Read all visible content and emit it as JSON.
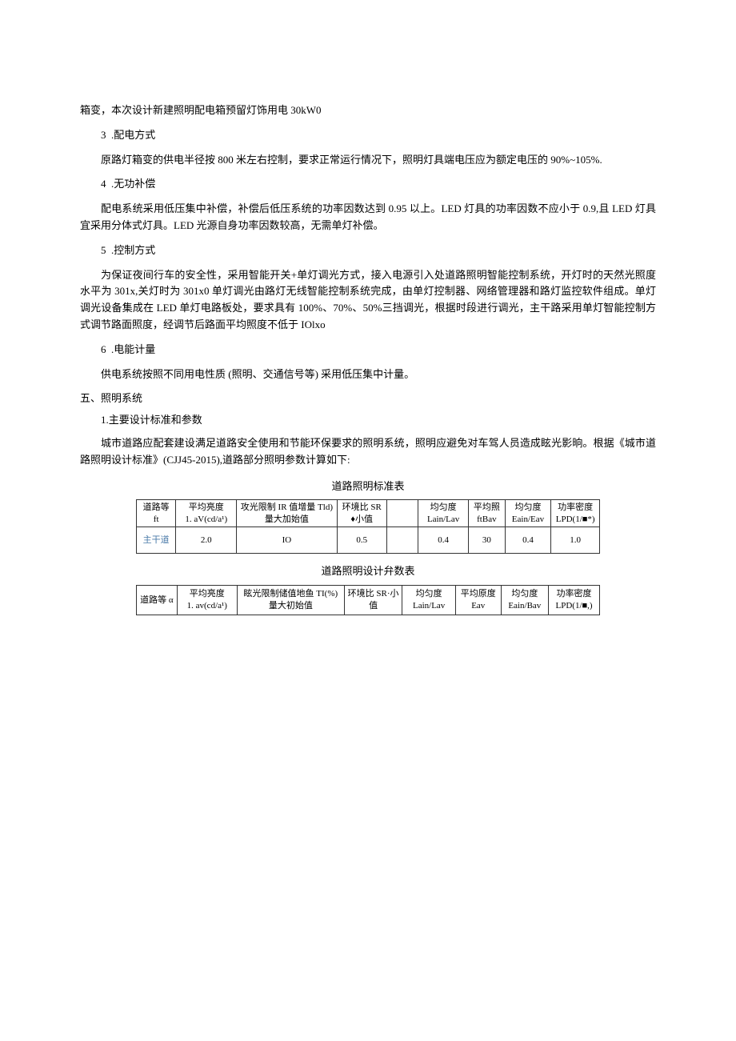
{
  "p1": "箱变，本次设计新建照明配电箱预留灯饰用电 30kW0",
  "item3": "3&nbsp;&nbsp;.配电方式",
  "p3": "原路灯箱变的供电半径按 800 米左右控制，要求正常运行情况下，照明灯具端电压应为额定电压的 90%~105%.",
  "item4": "4&nbsp;&nbsp;.无功补偿",
  "p4": "配电系统采用低压集中补偿，补偿后低压系统的功率因数达到 0.95 以上。LED 灯具的功率因数不应小于 0.9,且 LED 灯具宜采用分体式灯具。LED 光源自身功率因数较高，无需单灯补偿。",
  "item5": "5&nbsp;&nbsp;.控制方式",
  "p5": "为保证夜间行车的安全性，采用智能开关+单灯调光方式，接入电源引入处道路照明智能控制系统，开灯时的天然光照度水平为 301x,关灯时为 301x0 单灯调光由路灯无线智能控制系统完成，由单灯控制器、网络管理器和路灯监控软件组成。单灯调光设备集成在 LED 单灯电路板处，要求具有 100%、70%、50%三挡调光，根据时段进行调光，主干路采用单灯智能控制方式调节路面照度，经调节后路面平均照度不低于 IOlxo",
  "item6": "6&nbsp;&nbsp;.电能计量",
  "p6": "供电系统按照不同用电性质 (照明、交通信号等) 采用低压集中计量。",
  "sec5": "五、照明系统",
  "sub51": "1.主要设计标准和参数",
  "p51": "城市道路应配套建设满足道路安全使用和节能环保要求的照明系统，照明应避免对车驾人员造成眩光影晌。根据《城市道路照明设计标准》(CJJ45-2015),道路部分照明参数计算如下:",
  "table1_title": "道路照明标准表",
  "table1": {
    "headers": [
      "道路等 ft",
      "平均亮度\n1. aV(cd/a¹)",
      "攻光限制 IR 值增量 Tld)\n量大加始值",
      "环境比 SR\n♦小值",
      "",
      "均匀度\nLain/Lav",
      "平均照\nftBav",
      "均匀度\nEain/Eav",
      "功率密度\nLPD(1/■*)"
    ],
    "row": [
      "主干道",
      "2.0",
      "IO",
      "0.5",
      "",
      "0.4",
      "30",
      "0.4",
      "1.0"
    ]
  },
  "table2_title": "道路照明设计弁数表",
  "table2": {
    "headers": [
      "道路等 α",
      "平均亮度\n1. av(cd/a¹)",
      "眩光限制储值地鱼 TI(%)\n量大初始值",
      "环境比 SR·小\n值",
      "均匀度\nLain/Lav",
      "平均原度\nEav",
      "均匀度\nEain/Bav",
      "功率密度\nLPD(1/■,)"
    ]
  }
}
